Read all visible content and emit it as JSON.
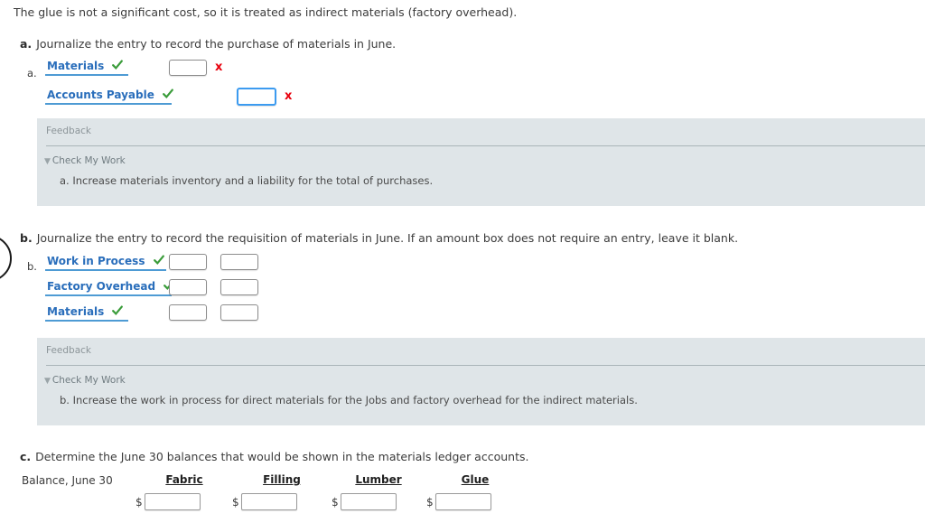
{
  "intro": {
    "text": "The glue is not a significant cost, so it is treated as indirect materials (factory overhead)."
  },
  "colors": {
    "account_link": "#2a6ebb",
    "account_underline": "#4e9bd4",
    "check_green": "#3a9c3a",
    "x_red": "#e8000d",
    "feedback_bg": "#dfe5e8",
    "input_border": "#8c8c8c",
    "input_focus_border": "#3c9bf0",
    "body_text": "#3b3b3b"
  },
  "sections": [
    {
      "letter": "a.",
      "prompt": "Journalize the entry to record the purchase of materials in June.",
      "entry_label": "a.",
      "lines": [
        {
          "account": "Materials",
          "status_icon": "check-icon",
          "debit": {
            "value": "",
            "state": "normal",
            "mark": "x-icon"
          },
          "credit": null
        },
        {
          "account": "Accounts Payable",
          "status_icon": "check-icon",
          "debit": null,
          "credit": {
            "value": "",
            "state": "focused",
            "mark": "x-icon"
          }
        }
      ],
      "feedback": {
        "title": "Feedback",
        "check_my_work": "Check My Work",
        "body": "a. Increase materials inventory and a liability for the total of purchases."
      }
    },
    {
      "letter": "b.",
      "prompt": "Journalize the entry to record the requisition of materials in June. If an amount box does not require an entry, leave it blank.",
      "entry_label": "b.",
      "lines": [
        {
          "account": "Work in Process",
          "status_icon": "check-icon",
          "debit": {
            "value": "",
            "state": "normal",
            "mark": null
          },
          "credit": {
            "value": "",
            "state": "normal",
            "mark": null
          }
        },
        {
          "account": "Factory Overhead",
          "status_icon": "check-icon",
          "debit": {
            "value": "",
            "state": "normal",
            "mark": null
          },
          "credit": {
            "value": "",
            "state": "normal",
            "mark": null
          }
        },
        {
          "account": "Materials",
          "status_icon": "check-icon",
          "debit": {
            "value": "",
            "state": "normal",
            "mark": null
          },
          "credit": {
            "value": "",
            "state": "normal",
            "mark": null
          }
        }
      ],
      "feedback": {
        "title": "Feedback",
        "check_my_work": "Check My Work",
        "body": "b. Increase the work in process for direct materials for the Jobs and factory overhead for the indirect materials."
      }
    },
    {
      "letter": "c.",
      "prompt": "Determine the June 30 balances that would be shown in the materials ledger accounts."
    }
  ],
  "ledger": {
    "row_label": "Balance, June 30",
    "currency_symbol": "$",
    "columns": [
      {
        "header": "Fabric",
        "value": ""
      },
      {
        "header": "Filling",
        "value": ""
      },
      {
        "header": "Lumber",
        "value": ""
      },
      {
        "header": "Glue",
        "value": ""
      }
    ]
  }
}
